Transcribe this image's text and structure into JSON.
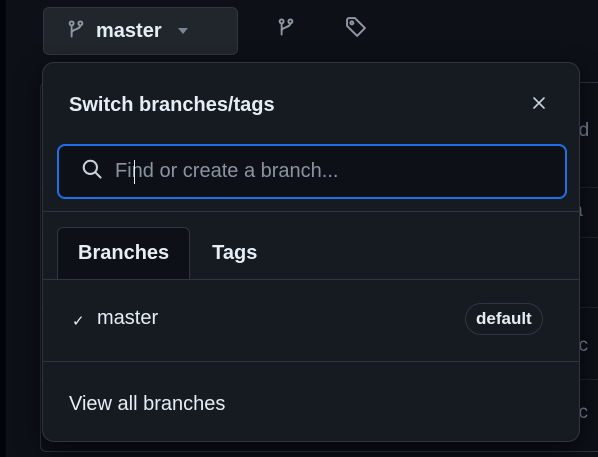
{
  "toolbar": {
    "branch_name": "master",
    "branch_icon": "git-branch-icon",
    "caret_icon": "triangle-down-icon",
    "branches_icon": "git-branch-icon",
    "tags_icon": "tag-icon"
  },
  "popover": {
    "title": "Switch branches/tags",
    "close_icon": "x-icon",
    "search": {
      "placeholder": "Find or create a branch...",
      "value": "",
      "icon": "search-icon"
    },
    "tabs": [
      {
        "label": "Branches",
        "active": true
      },
      {
        "label": "Tags",
        "active": false
      }
    ],
    "branches": [
      {
        "check": "✓",
        "name": "master",
        "badge": "default",
        "selected": true
      }
    ],
    "footer_link": "View all branches"
  },
  "background_peek": [
    "nd",
    "ia",
    "d",
    "t c",
    "t c"
  ],
  "colors": {
    "page_bg": "#0d1117",
    "popover_bg": "#161b22",
    "border": "#30363d",
    "focus_ring": "#1f6feb",
    "text": "#e6edf3",
    "muted": "#8b949e"
  }
}
